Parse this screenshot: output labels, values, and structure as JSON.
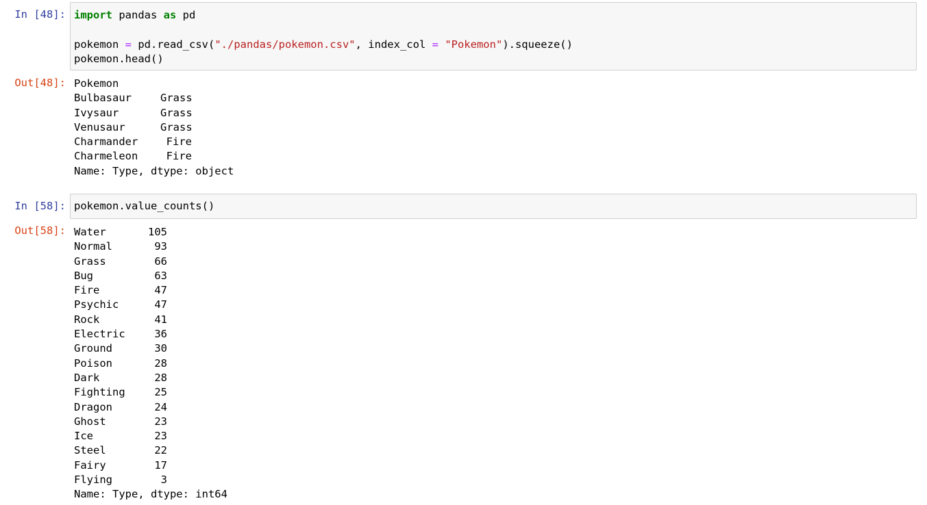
{
  "cells": [
    {
      "in_prompt": "In [48]:",
      "out_prompt": "Out[48]:",
      "code": {
        "line1": {
          "kw1": "import",
          "t1": " pandas ",
          "kw2": "as",
          "t2": " pd"
        },
        "line3": {
          "t1": "pokemon ",
          "op": "=",
          "t2": " pd.read_csv(",
          "str1": "\"./pandas/pokemon.csv\"",
          "t3": ", index_col ",
          "op2": "=",
          "t4": " ",
          "str2": "\"Pokemon\"",
          "t5": ").squeeze()"
        },
        "line4": "pokemon.head()"
      },
      "output": {
        "header": "Pokemon",
        "rows": [
          {
            "name": "Bulbasaur",
            "value": "Grass"
          },
          {
            "name": "Ivysaur",
            "value": "Grass"
          },
          {
            "name": "Venusaur",
            "value": "Grass"
          },
          {
            "name": "Charmander",
            "value": "Fire"
          },
          {
            "name": "Charmeleon",
            "value": "Fire"
          }
        ],
        "footer": "Name: Type, dtype: object"
      }
    },
    {
      "in_prompt": "In [58]:",
      "out_prompt": "Out[58]:",
      "code": "pokemon.value_counts()",
      "output": {
        "rows": [
          {
            "label": "Water",
            "count": "105"
          },
          {
            "label": "Normal",
            "count": "93"
          },
          {
            "label": "Grass",
            "count": "66"
          },
          {
            "label": "Bug",
            "count": "63"
          },
          {
            "label": "Fire",
            "count": "47"
          },
          {
            "label": "Psychic",
            "count": "47"
          },
          {
            "label": "Rock",
            "count": "41"
          },
          {
            "label": "Electric",
            "count": "36"
          },
          {
            "label": "Ground",
            "count": "30"
          },
          {
            "label": "Poison",
            "count": "28"
          },
          {
            "label": "Dark",
            "count": "28"
          },
          {
            "label": "Fighting",
            "count": "25"
          },
          {
            "label": "Dragon",
            "count": "24"
          },
          {
            "label": "Ghost",
            "count": "23"
          },
          {
            "label": "Ice",
            "count": "23"
          },
          {
            "label": "Steel",
            "count": "22"
          },
          {
            "label": "Fairy",
            "count": "17"
          },
          {
            "label": "Flying",
            "count": "3"
          }
        ],
        "footer": "Name: Type, dtype: int64"
      }
    }
  ]
}
